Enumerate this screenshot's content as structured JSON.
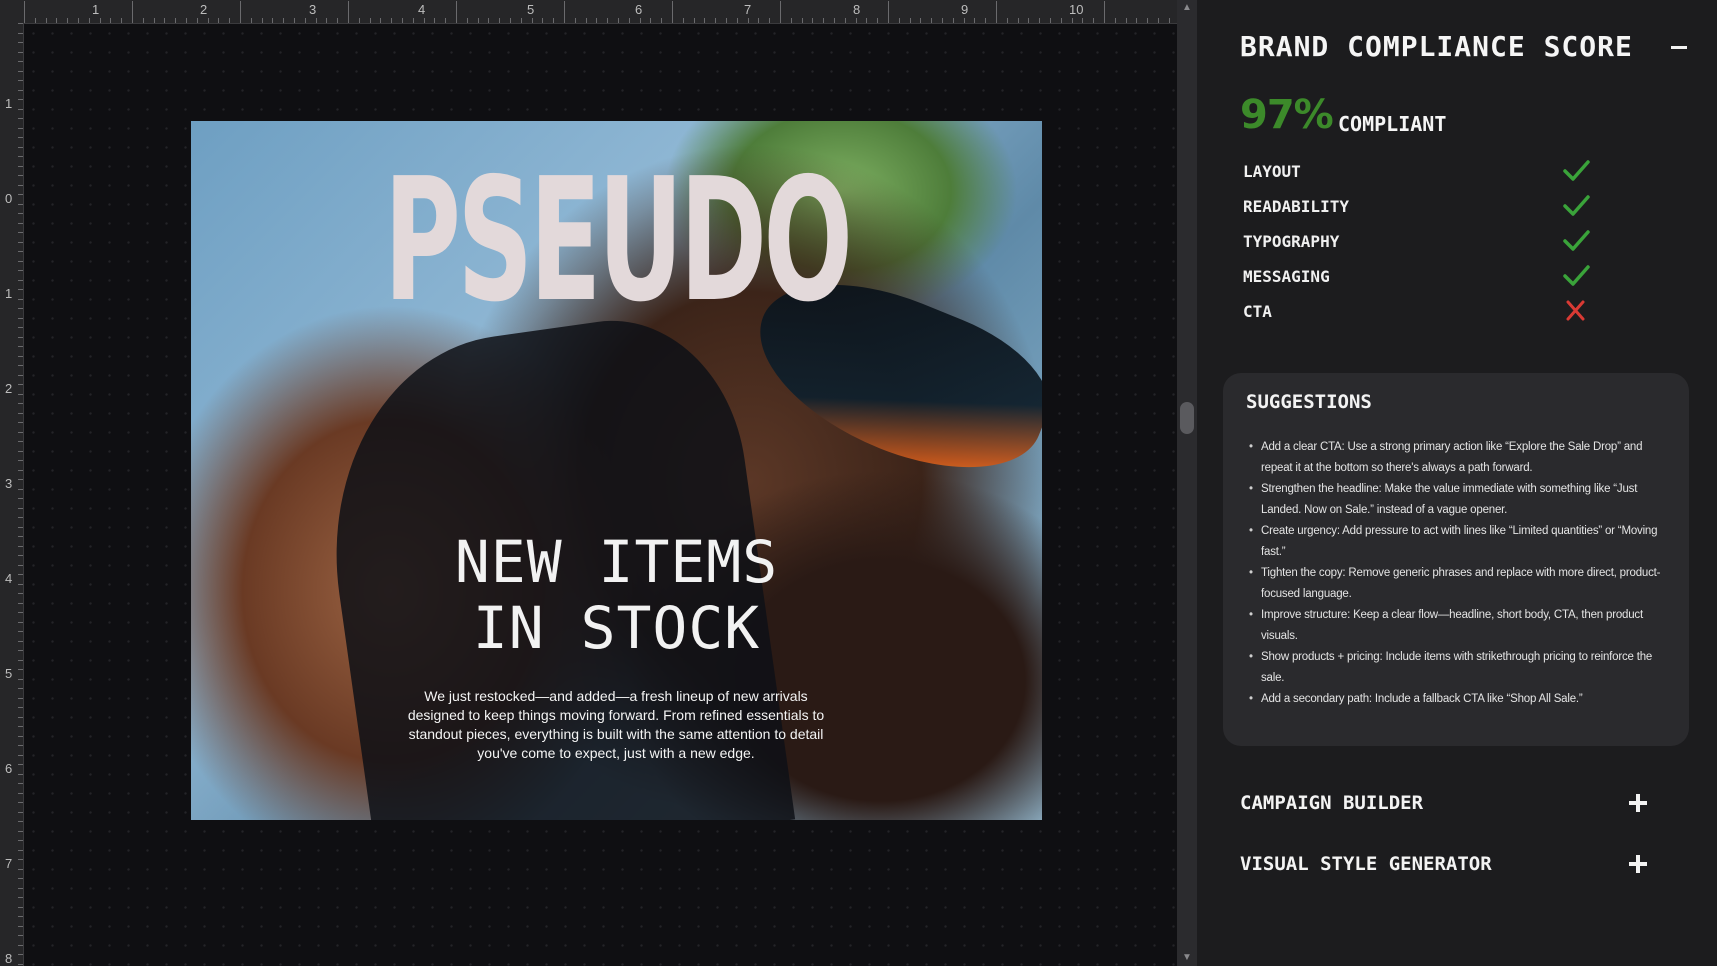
{
  "ruler": {
    "top_numbers": [
      "1",
      "2",
      "3",
      "4",
      "5",
      "6",
      "7",
      "8",
      "9",
      "10"
    ],
    "left_numbers": [
      "1",
      "0",
      "1",
      "2",
      "3",
      "4",
      "5",
      "6",
      "7",
      "8"
    ]
  },
  "poster": {
    "brand": "PSEUDO",
    "headline_line1": "NEW ITEMS",
    "headline_line2": "IN STOCK",
    "body": "We just restocked—and added—a fresh lineup of new arrivals designed to keep things moving forward. From refined essentials to standout pieces, everything is built with the same attention to detail you've come to expect, just with a new edge."
  },
  "compliance": {
    "title": "BRAND COMPLIANCE SCORE",
    "score": "97%",
    "status": "COMPLIANT",
    "checks": [
      {
        "label": "LAYOUT",
        "icon": "check-icon",
        "pass": true
      },
      {
        "label": "READABILITY",
        "icon": "check-icon",
        "pass": true
      },
      {
        "label": "TYPOGRAPHY",
        "icon": "check-icon",
        "pass": true
      },
      {
        "label": "MESSAGING",
        "icon": "check-icon",
        "pass": true
      },
      {
        "label": "CTA",
        "icon": "cross-icon",
        "pass": false
      }
    ],
    "colors": {
      "pass": "#3aa33a",
      "fail": "#d93a34",
      "score": "#3c8a2a"
    }
  },
  "suggestions": {
    "title": "SUGGESTIONS",
    "items": [
      "Add a clear CTA: Use a strong primary action like “Explore the Sale Drop” and repeat it at the bottom so there's always a path forward.",
      "Strengthen the headline: Make the value immediate with something like “Just Landed. Now on Sale.” instead of a vague opener.",
      "Create urgency: Add pressure to act with lines like “Limited quantities” or “Moving fast.”",
      "Tighten the copy: Remove generic phrases and replace with more direct, product-focused language.",
      "Improve structure: Keep a clear flow—headline, short body, CTA, then product visuals.",
      "Show products + pricing: Include items with strikethrough pricing to reinforce the sale.",
      "Add a secondary path: Include a fallback CTA like “Shop All Sale.”"
    ]
  },
  "sections": {
    "campaign_builder": "CAMPAIGN BUILDER",
    "visual_style_generator": "VISUAL STYLE GENERATOR"
  }
}
